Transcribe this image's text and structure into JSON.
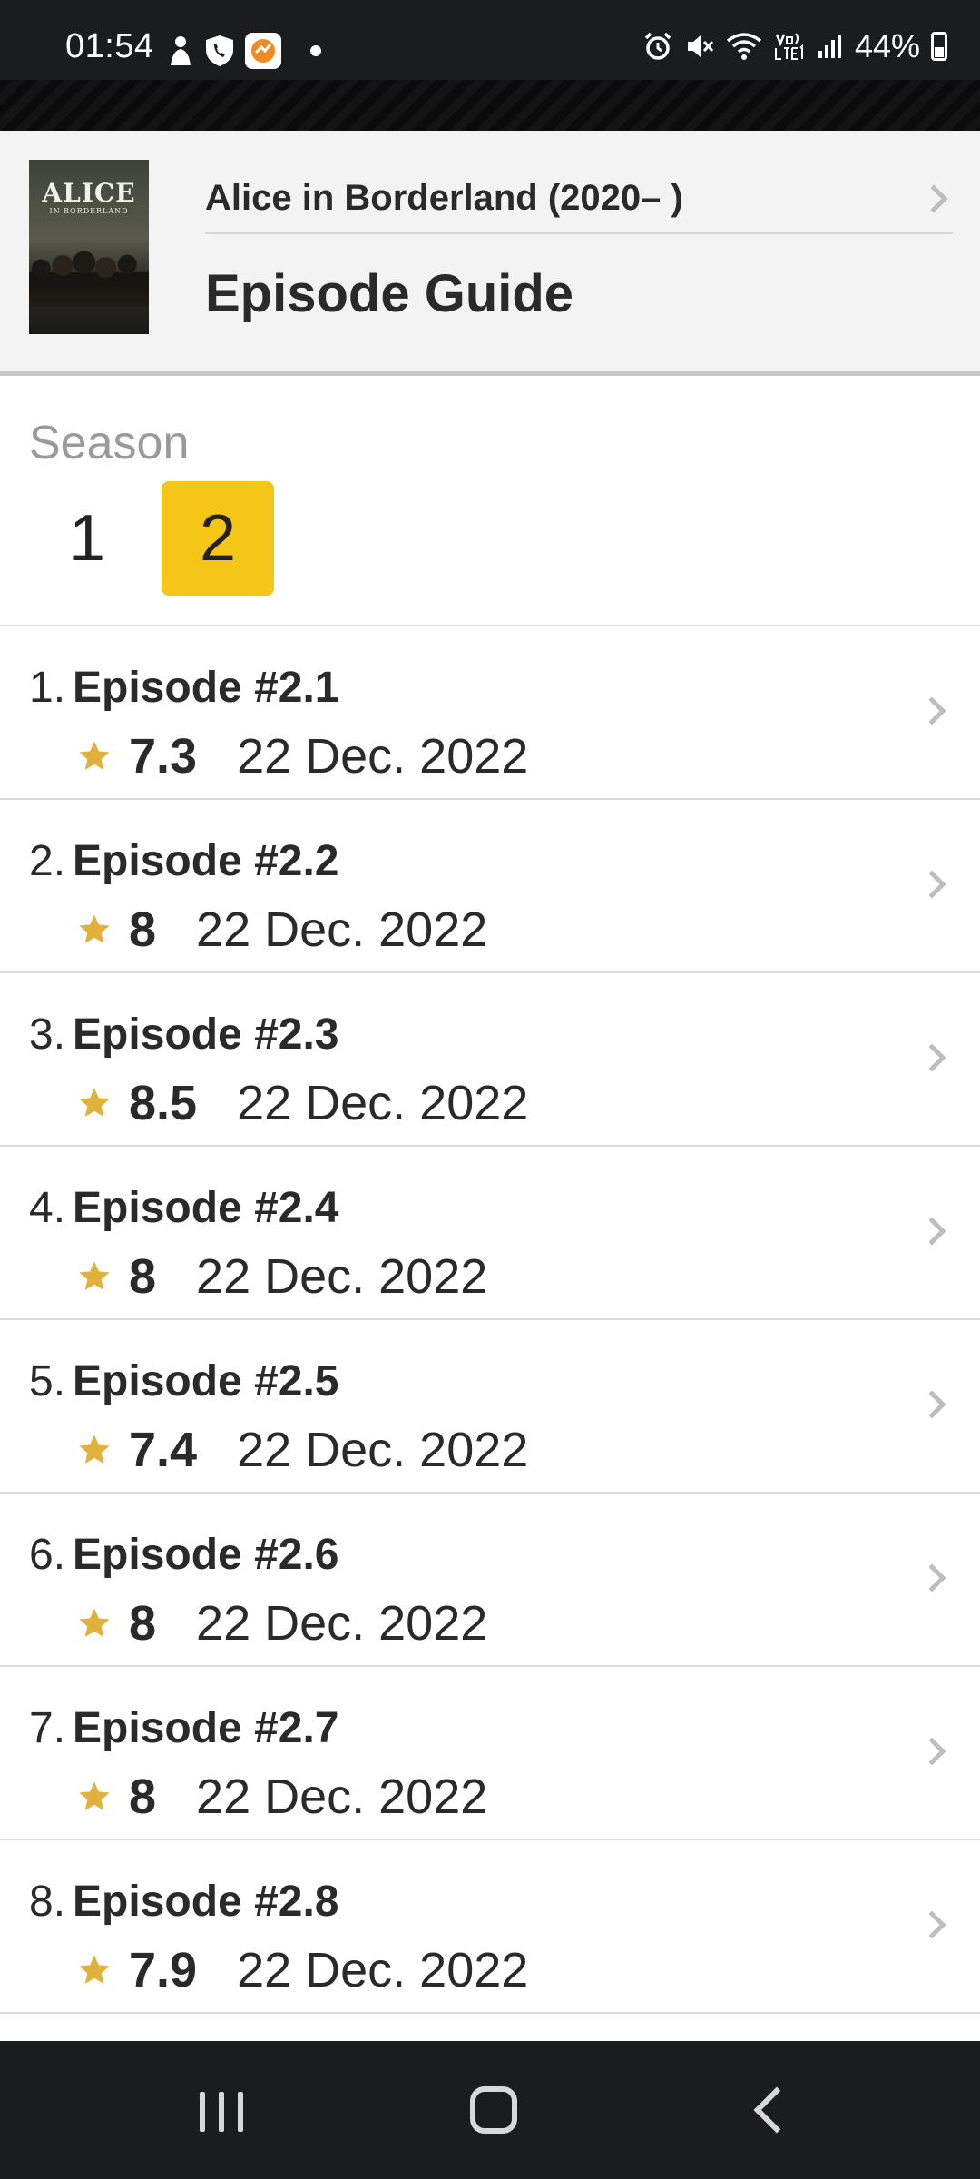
{
  "status_bar": {
    "time": "01:54",
    "battery": "44%",
    "left_icons": [
      "person-icon",
      "call-shield-icon",
      "app-badge-icon",
      "notification-dot"
    ],
    "right_icons": [
      "alarm-icon",
      "mute-icon",
      "wifi-icon",
      "volte-icon",
      "signal-icon",
      "battery-icon"
    ]
  },
  "header": {
    "poster_title": "ALICE",
    "poster_subtitle": "IN BORDERLAND",
    "show_title": "Alice in Borderland (2020– )",
    "page_title": "Episode Guide"
  },
  "season": {
    "label": "Season",
    "options": [
      "1",
      "2"
    ],
    "selected": "2",
    "accent_color": "#f5c518"
  },
  "episodes": [
    {
      "num": "1.",
      "title": "Episode #2.1",
      "rating": "7.3",
      "date": "22 Dec. 2022"
    },
    {
      "num": "2.",
      "title": "Episode #2.2",
      "rating": "8",
      "date": "22 Dec. 2022"
    },
    {
      "num": "3.",
      "title": "Episode #2.3",
      "rating": "8.5",
      "date": "22 Dec. 2022"
    },
    {
      "num": "4.",
      "title": "Episode #2.4",
      "rating": "8",
      "date": "22 Dec. 2022"
    },
    {
      "num": "5.",
      "title": "Episode #2.5",
      "rating": "7.4",
      "date": "22 Dec. 2022"
    },
    {
      "num": "6.",
      "title": "Episode #2.6",
      "rating": "8",
      "date": "22 Dec. 2022"
    },
    {
      "num": "7.",
      "title": "Episode #2.7",
      "rating": "8",
      "date": "22 Dec. 2022"
    },
    {
      "num": "8.",
      "title": "Episode #2.8",
      "rating": "7.9",
      "date": "22 Dec. 2022"
    }
  ],
  "colors": {
    "star": "#e2b13c",
    "status_bar_bg": "#1b1c1e"
  },
  "nav_bar": {
    "icons": [
      "recents-icon",
      "home-icon",
      "back-icon"
    ]
  }
}
